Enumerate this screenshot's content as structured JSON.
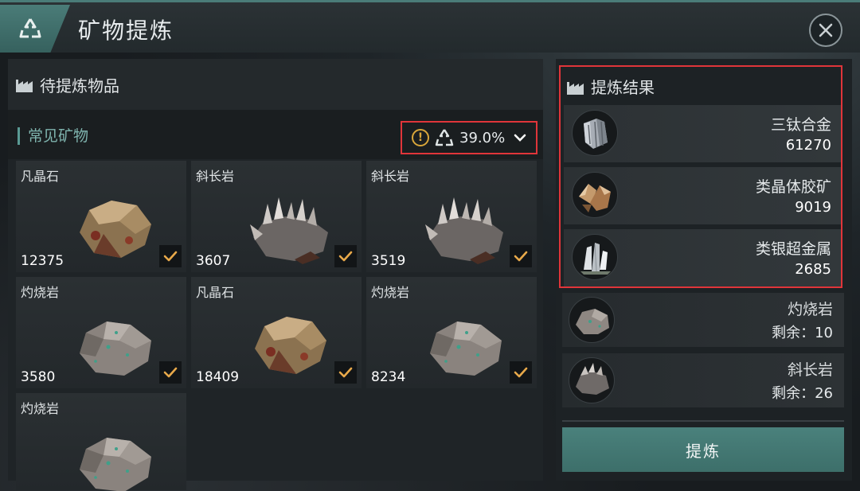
{
  "header": {
    "title": "矿物提炼",
    "logo_icon": "recycle-icon",
    "close_icon": "close-icon"
  },
  "left": {
    "heading": "待提炼物品",
    "category": "常见矿物",
    "rate": "39.0%",
    "items": [
      {
        "name": "凡晶石",
        "qty": "12375",
        "rock": "gold"
      },
      {
        "name": "斜长岩",
        "qty": "3607",
        "rock": "spiky"
      },
      {
        "name": "斜长岩",
        "qty": "3519",
        "rock": "spiky"
      },
      {
        "name": "灼烧岩",
        "qty": "3580",
        "rock": "grey"
      },
      {
        "name": "凡晶石",
        "qty": "18409",
        "rock": "gold"
      },
      {
        "name": "灼烧岩",
        "qty": "8234",
        "rock": "grey"
      },
      {
        "name": "灼烧岩",
        "qty": "",
        "rock": "grey"
      }
    ]
  },
  "right": {
    "heading": "提炼结果",
    "results": [
      {
        "name": "三钛合金",
        "qty": "61270"
      },
      {
        "name": "类晶体胶矿",
        "qty": "9019"
      },
      {
        "name": "类银超金属",
        "qty": "2685"
      }
    ],
    "remaining": [
      {
        "name": "灼烧岩",
        "qty": "剩余：10"
      },
      {
        "name": "斜长岩",
        "qty": "剩余：26"
      }
    ],
    "refine_label": "提炼"
  },
  "colors": {
    "accent": "#4a7c78",
    "highlight_border": "#e0353a",
    "check": "#e8a94a",
    "warning": "#d9a63a"
  }
}
